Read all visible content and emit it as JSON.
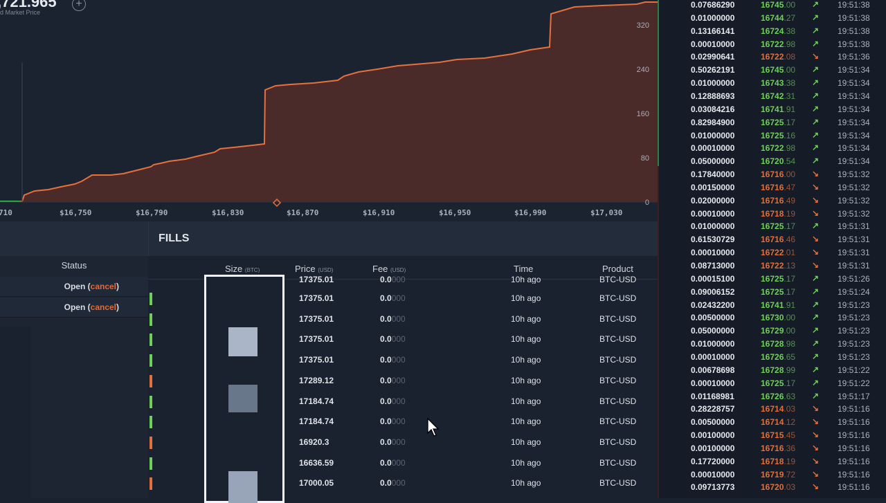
{
  "depth_chart": {
    "mid_price": ",721.965",
    "mid_price_label": "id Market Price",
    "x_ticks": [
      "710",
      "$16,750",
      "$16,790",
      "$16,830",
      "$16,870",
      "$16,910",
      "$16,950",
      "$16,990",
      "$17,030"
    ],
    "y_ticks": [
      "320",
      "240",
      "160",
      "80",
      "0"
    ],
    "colors": {
      "line": "#e8703c",
      "fill": "#4a2b29",
      "axis": "#a7b0ba"
    }
  },
  "orders": {
    "status_header": "Status",
    "rows": [
      {
        "status": "Open",
        "action": "cancel"
      },
      {
        "status": "Open",
        "action": "cancel"
      }
    ]
  },
  "fills": {
    "title": "FILLS",
    "headers": {
      "size": "Size",
      "size_unit": "(BTC)",
      "price": "Price",
      "price_unit": "(USD)",
      "fee": "Fee",
      "fee_unit": "(USD)",
      "time": "Time",
      "product": "Product"
    },
    "partial_row": {
      "price": "17375.01",
      "fee": "0.0",
      "fee_dim": "000",
      "time": "10h ago",
      "product": "BTC-USD"
    },
    "rows": [
      {
        "side": "buy",
        "price": "17375.01",
        "fee": "0.0",
        "fee_dim": "000",
        "time": "10h ago",
        "product": "BTC-USD"
      },
      {
        "side": "buy",
        "price": "17375.01",
        "fee": "0.0",
        "fee_dim": "000",
        "time": "10h ago",
        "product": "BTC-USD"
      },
      {
        "side": "buy",
        "price": "17375.01",
        "fee": "0.0",
        "fee_dim": "000",
        "time": "10h ago",
        "product": "BTC-USD"
      },
      {
        "side": "buy",
        "price": "17375.01",
        "fee": "0.0",
        "fee_dim": "000",
        "time": "10h ago",
        "product": "BTC-USD"
      },
      {
        "side": "sell",
        "price": "17289.12",
        "fee": "0.0",
        "fee_dim": "000",
        "time": "10h ago",
        "product": "BTC-USD"
      },
      {
        "side": "buy",
        "price": "17184.74",
        "fee": "0.0",
        "fee_dim": "000",
        "time": "10h ago",
        "product": "BTC-USD"
      },
      {
        "side": "buy",
        "price": "17184.74",
        "fee": "0.0",
        "fee_dim": "000",
        "time": "10h ago",
        "product": "BTC-USD"
      },
      {
        "side": "sell",
        "price": "16920.3",
        "fee": "0.0",
        "fee_dim": "000",
        "time": "10h ago",
        "product": "BTC-USD"
      },
      {
        "side": "buy",
        "price": "16636.59",
        "fee": "0.0",
        "fee_dim": "000",
        "time": "10h ago",
        "product": "BTC-USD"
      },
      {
        "side": "sell",
        "price": "17000.05",
        "fee": "0.0",
        "fee_dim": "000",
        "time": "10h ago",
        "product": "BTC-USD"
      }
    ],
    "colors": {
      "buy": "#6fd05a",
      "sell": "#e0703c"
    }
  },
  "trade_history": [
    {
      "size": "0.07686290",
      "price_hi": "16745",
      "price_lo": ".00",
      "dir": "up",
      "time": "19:51:38"
    },
    {
      "size": "0.01000000",
      "price_hi": "16744",
      "price_lo": ".27",
      "dir": "up",
      "time": "19:51:38"
    },
    {
      "size": "0.13166141",
      "price_hi": "16724",
      "price_lo": ".38",
      "dir": "up",
      "time": "19:51:38"
    },
    {
      "size": "0.00010000",
      "price_hi": "16722",
      "price_lo": ".98",
      "dir": "up",
      "time": "19:51:38"
    },
    {
      "size": "0.02990641",
      "price_hi": "16722",
      "price_lo": ".08",
      "dir": "down",
      "time": "19:51:36"
    },
    {
      "size": "0.50262191",
      "price_hi": "16745",
      "price_lo": ".00",
      "dir": "up",
      "time": "19:51:34"
    },
    {
      "size": "0.01000000",
      "price_hi": "16743",
      "price_lo": ".38",
      "dir": "up",
      "time": "19:51:34"
    },
    {
      "size": "0.12888693",
      "price_hi": "16742",
      "price_lo": ".31",
      "dir": "up",
      "time": "19:51:34"
    },
    {
      "size": "0.03084216",
      "price_hi": "16741",
      "price_lo": ".91",
      "dir": "up",
      "time": "19:51:34"
    },
    {
      "size": "0.82984900",
      "price_hi": "16725",
      "price_lo": ".17",
      "dir": "up",
      "time": "19:51:34"
    },
    {
      "size": "0.01000000",
      "price_hi": "16725",
      "price_lo": ".16",
      "dir": "up",
      "time": "19:51:34"
    },
    {
      "size": "0.00010000",
      "price_hi": "16722",
      "price_lo": ".98",
      "dir": "up",
      "time": "19:51:34"
    },
    {
      "size": "0.05000000",
      "price_hi": "16720",
      "price_lo": ".54",
      "dir": "up",
      "time": "19:51:34"
    },
    {
      "size": "0.17840000",
      "price_hi": "16716",
      "price_lo": ".00",
      "dir": "down",
      "time": "19:51:32"
    },
    {
      "size": "0.00150000",
      "price_hi": "16716",
      "price_lo": ".47",
      "dir": "down",
      "time": "19:51:32"
    },
    {
      "size": "0.02000000",
      "price_hi": "16716",
      "price_lo": ".49",
      "dir": "down",
      "time": "19:51:32"
    },
    {
      "size": "0.00010000",
      "price_hi": "16718",
      "price_lo": ".19",
      "dir": "down",
      "time": "19:51:32"
    },
    {
      "size": "0.01000000",
      "price_hi": "16725",
      "price_lo": ".17",
      "dir": "up",
      "time": "19:51:31"
    },
    {
      "size": "0.61530729",
      "price_hi": "16716",
      "price_lo": ".46",
      "dir": "down",
      "time": "19:51:31"
    },
    {
      "size": "0.00010000",
      "price_hi": "16722",
      "price_lo": ".01",
      "dir": "down",
      "time": "19:51:31"
    },
    {
      "size": "0.08713000",
      "price_hi": "16722",
      "price_lo": ".13",
      "dir": "down",
      "time": "19:51:31"
    },
    {
      "size": "0.00015100",
      "price_hi": "16725",
      "price_lo": ".17",
      "dir": "up",
      "time": "19:51:26"
    },
    {
      "size": "0.09006152",
      "price_hi": "16725",
      "price_lo": ".17",
      "dir": "up",
      "time": "19:51:24"
    },
    {
      "size": "0.02432200",
      "price_hi": "16741",
      "price_lo": ".91",
      "dir": "up",
      "time": "19:51:23"
    },
    {
      "size": "0.00500000",
      "price_hi": "16730",
      "price_lo": ".00",
      "dir": "up",
      "time": "19:51:23"
    },
    {
      "size": "0.05000000",
      "price_hi": "16729",
      "price_lo": ".00",
      "dir": "up",
      "time": "19:51:23"
    },
    {
      "size": "0.01000000",
      "price_hi": "16728",
      "price_lo": ".98",
      "dir": "up",
      "time": "19:51:23"
    },
    {
      "size": "0.00010000",
      "price_hi": "16726",
      "price_lo": ".65",
      "dir": "up",
      "time": "19:51:23"
    },
    {
      "size": "0.00678698",
      "price_hi": "16728",
      "price_lo": ".99",
      "dir": "up",
      "time": "19:51:22"
    },
    {
      "size": "0.00010000",
      "price_hi": "16725",
      "price_lo": ".17",
      "dir": "up",
      "time": "19:51:22"
    },
    {
      "size": "0.01168981",
      "price_hi": "16726",
      "price_lo": ".63",
      "dir": "up",
      "time": "19:51:17"
    },
    {
      "size": "0.28228757",
      "price_hi": "16714",
      "price_lo": ".03",
      "dir": "down",
      "time": "19:51:16"
    },
    {
      "size": "0.00500000",
      "price_hi": "16714",
      "price_lo": ".12",
      "dir": "down",
      "time": "19:51:16"
    },
    {
      "size": "0.00100000",
      "price_hi": "16715",
      "price_lo": ".45",
      "dir": "down",
      "time": "19:51:16"
    },
    {
      "size": "0.00100000",
      "price_hi": "16716",
      "price_lo": ".36",
      "dir": "down",
      "time": "19:51:16"
    },
    {
      "size": "0.17720000",
      "price_hi": "16718",
      "price_lo": ".19",
      "dir": "down",
      "time": "19:51:16"
    },
    {
      "size": "0.00010000",
      "price_hi": "16719",
      "price_lo": ".72",
      "dir": "down",
      "time": "19:51:16"
    },
    {
      "size": "0.09713773",
      "price_hi": "16720",
      "price_lo": ".03",
      "dir": "down",
      "time": "19:51:16"
    }
  ],
  "icons": {
    "up_arrow": "↗",
    "down_arrow": "↘"
  }
}
